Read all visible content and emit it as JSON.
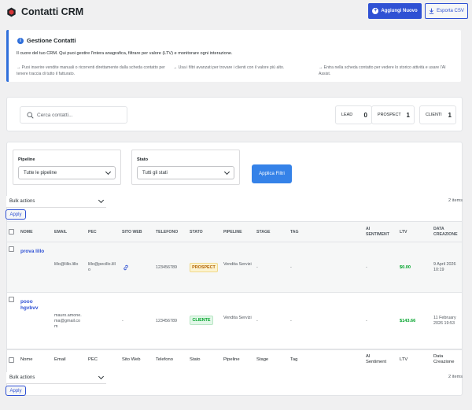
{
  "header": {
    "title": "Contatti CRM",
    "add_button": "Aggiungi Nuovo",
    "export_button": "Esporta CSV"
  },
  "info": {
    "title": "Gestione Contatti",
    "description": "Il cuore del tuo CRM. Qui puoi gestire l'intera anagrafica, filtrare per valore (LTV) e monitorare ogni interazione.",
    "tips": [
      "→ Puoi inserire vendite manuali o ricorrenti direttamente dalla scheda contatto per tenere traccia di tutto il fatturato.",
      "→ Usa i filtri avanzati per trovare i clienti con il valore più alto.",
      "→ Entra nella scheda contatto per vedere lo storico attività e usare l'AI Assist."
    ]
  },
  "search": {
    "placeholder": "Cerca contatti..."
  },
  "stats": [
    {
      "label": "LEAD",
      "count": "0"
    },
    {
      "label": "PROSPECT",
      "count": "1"
    },
    {
      "label": "CLIENTI",
      "count": "1"
    }
  ],
  "filters": {
    "pipeline_label": "Pipeline",
    "pipeline_value": "Tutte le pipeline",
    "stato_label": "Stato",
    "stato_value": "Tutti gli stati",
    "apply_label": "Applica Filtri"
  },
  "table": {
    "bulk_actions": "Bulk actions",
    "apply": "Apply",
    "items_count": "2 items",
    "header_columns": [
      "NOME",
      "EMAIL",
      "PEC",
      "SITO WEB",
      "TELEFONO",
      "STATO",
      "PIPELINE",
      "STAGE",
      "TAG",
      "AI SENTIMENT",
      "LTV",
      "DATA CREAZIONE"
    ],
    "footer_columns": [
      "Nome",
      "Email",
      "PEC",
      "Sito Web",
      "Telefono",
      "Stato",
      "Pipeline",
      "Stage",
      "Tag",
      "AI Sentiment",
      "LTV",
      "Data Creazione"
    ],
    "rows": [
      {
        "name": "prova lillo",
        "email": "lillo@lillo.lillo",
        "pec": "lillo@pecillo.lillo",
        "sito": "",
        "telefono": "123456789",
        "stato": "PROSPECT",
        "pipeline": "Vendita Servizi",
        "stage": "-",
        "tag": "-",
        "sentiment": "-",
        "ltv": "$0.00",
        "data": "9 April 2026 10:19"
      },
      {
        "name": "pooo hgvbvv",
        "email": "mauro.amone.ma@gmail.com",
        "pec": "",
        "sito": "-",
        "telefono": "123456789",
        "stato": "CLIENTE",
        "pipeline": "Vendita Servizi",
        "stage": "-",
        "tag": "-",
        "sentiment": "-",
        "ltv": "$143.66",
        "data": "11 February 2026 19:53"
      }
    ]
  },
  "colors": {
    "primary": "#2f51d4",
    "info_accent": "#2f6fdb",
    "apply_filters": "#3582e8",
    "prospect": "#b26200",
    "cliente": "#00a32a"
  }
}
